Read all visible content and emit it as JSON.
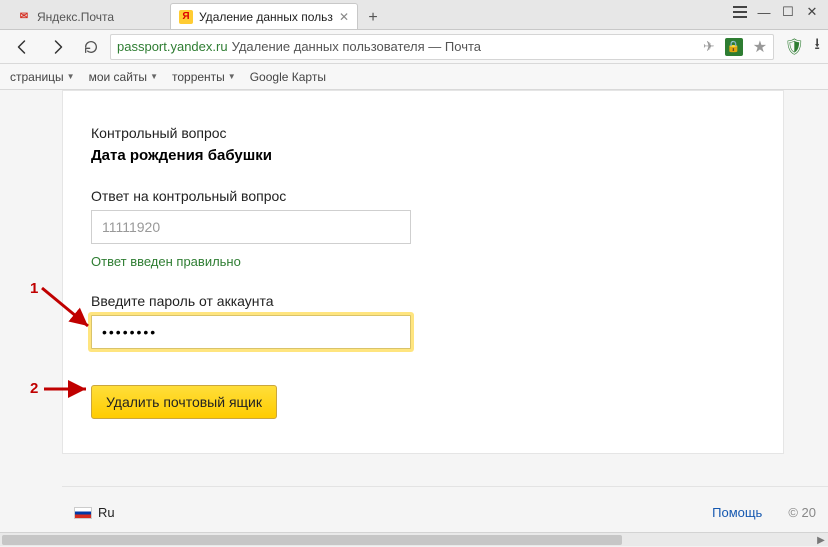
{
  "tabs": {
    "tab1": {
      "label": "Яндекс.Почта"
    },
    "tab2": {
      "label": "Удаление данных польз"
    }
  },
  "address": {
    "host": "passport.yandex.ru",
    "rest": "Удаление данных пользователя — Почта"
  },
  "bookmarks": {
    "b1": "страницы",
    "b2": "мои сайты",
    "b3": "торренты",
    "b4": "Google Карты"
  },
  "form": {
    "section_label": "Контрольный вопрос",
    "question": "Дата рождения бабушки",
    "answer_label": "Ответ на контрольный вопрос",
    "answer_value": "11111920",
    "answer_ok": "Ответ введен правильно",
    "password_label": "Введите пароль от аккаунта",
    "password_value": "••••••••",
    "delete_label": "Удалить почтовый ящик"
  },
  "annotations": {
    "one": "1",
    "two": "2"
  },
  "footer": {
    "lang": "Ru",
    "help": "Помощь",
    "copyright": "© 20"
  }
}
